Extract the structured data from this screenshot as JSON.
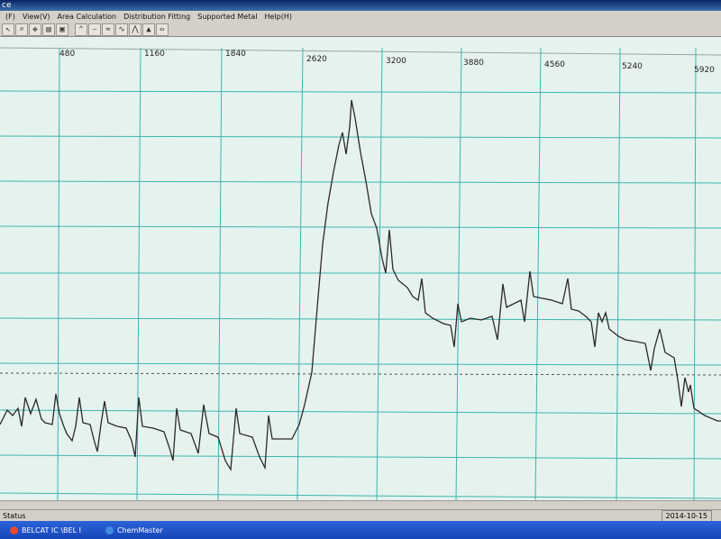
{
  "window": {
    "title": "ce"
  },
  "menu": {
    "items": [
      "(F)",
      "View(V)",
      "Area Calculation",
      "Distribution Fitting",
      "Supported Metal",
      "Help(H)"
    ]
  },
  "toolbar": {
    "icons": [
      "cursor-icon",
      "zoom-icon",
      "pan-icon",
      "print-icon",
      "save-icon",
      "peak-icon",
      "baseline-icon",
      "area-icon",
      "fit-icon",
      "marker-icon",
      "triangle-icon",
      "range-icon"
    ]
  },
  "plot": {
    "x_ticks": [
      "480",
      "1160",
      "1840",
      "2620",
      "3200",
      "3880",
      "4560",
      "5240",
      "5920"
    ],
    "grid_color": "#3bb6ad",
    "trace_color": "#2a2a2a"
  },
  "status": {
    "label": "Status",
    "date": "2014-10-15"
  },
  "taskbar": {
    "tasks": [
      {
        "label": "BELCAT IC \\BEL I"
      },
      {
        "label": "ChemMaster"
      }
    ]
  }
}
